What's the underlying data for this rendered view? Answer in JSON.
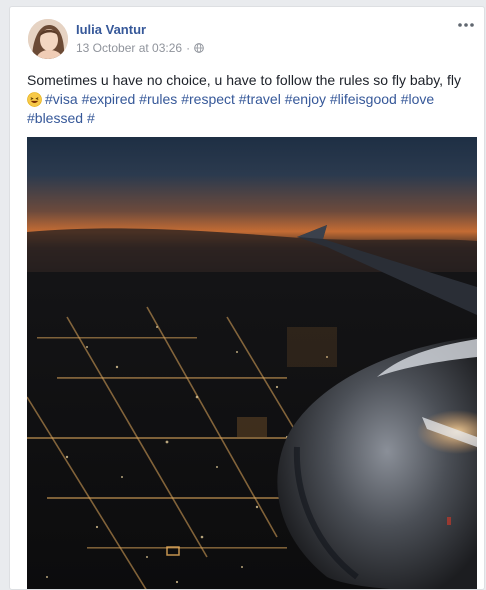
{
  "post": {
    "author": "Iulia Vantur",
    "timestamp": "13 October at 03:26",
    "separator": "·",
    "privacy_icon": "globe-icon",
    "more_icon": "ellipsis-icon",
    "text_line1": "Sometimes u have no choice, u have to follow the rules so fly baby, fly",
    "emoji": "laughing-emoji",
    "hashtags": [
      "#visa",
      "#expired",
      "#rules",
      "#respect",
      "#travel",
      "#enjoy",
      "#lifeisgood",
      "#love",
      "#blessed",
      "#"
    ],
    "photo_subject": "night-sky-airplane-wing-city-lights"
  },
  "colors": {
    "link": "#365899",
    "meta": "#90949c",
    "text": "#1d2129",
    "background": "#e9ebee"
  }
}
